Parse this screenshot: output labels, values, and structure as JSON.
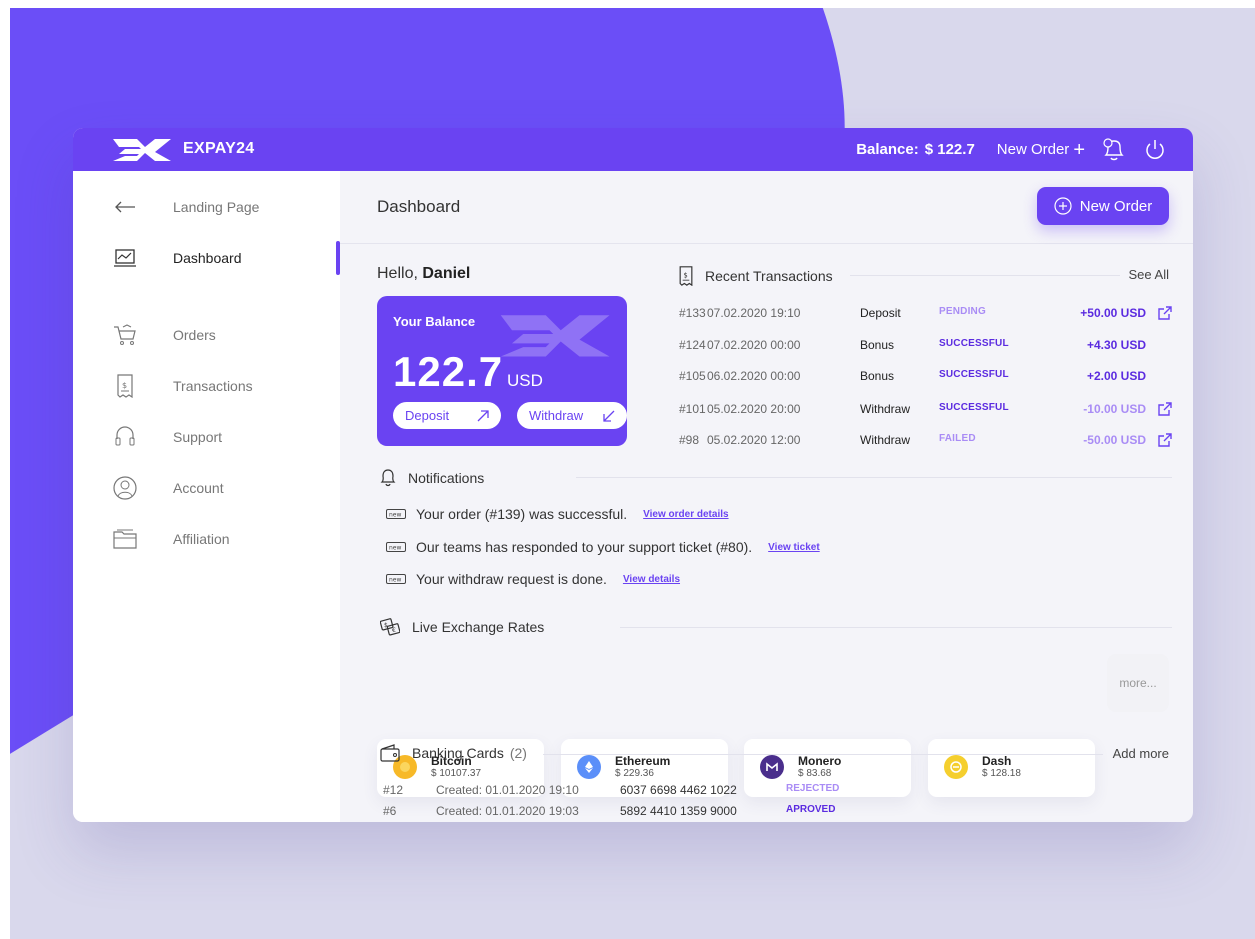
{
  "topbar": {
    "brand": "EXPAY24",
    "balance_label": "Balance:",
    "balance_value": "$ 122.7",
    "new_order_label": "New Order",
    "icons": [
      "logo-icon",
      "plus-icon",
      "notification-bell-icon",
      "power-icon"
    ]
  },
  "sidebar": {
    "items": [
      {
        "label": "Landing Page",
        "icon": "arrow-left-icon"
      },
      {
        "label": "Dashboard",
        "icon": "monitor-chart-icon",
        "active": true
      },
      {
        "label": "Orders",
        "icon": "cart-icon"
      },
      {
        "label": "Transactions",
        "icon": "receipt-icon"
      },
      {
        "label": "Support",
        "icon": "headset-icon"
      },
      {
        "label": "Account",
        "icon": "user-circle-icon"
      },
      {
        "label": "Affiliation",
        "icon": "folder-icon"
      }
    ]
  },
  "header": {
    "title": "Dashboard",
    "new_order_button": "New Order"
  },
  "greeting": {
    "prefix": "Hello,",
    "name": "Daniel"
  },
  "balance_card": {
    "label": "Your Balance",
    "amount": "122.7",
    "currency": "USD",
    "deposit_label": "Deposit",
    "withdraw_label": "Withdraw"
  },
  "transactions": {
    "title": "Recent Transactions",
    "see_all": "See All",
    "rows": [
      {
        "id": "#133",
        "date": "07.02.2020 19:10",
        "type": "Deposit",
        "status": "PENDING",
        "amount": "+50.00 USD",
        "link": true
      },
      {
        "id": "#124",
        "date": "07.02.2020 00:00",
        "type": "Bonus",
        "status": "SUCCESSFUL",
        "amount": "+4.30 USD",
        "link": false
      },
      {
        "id": "#105",
        "date": "06.02.2020 00:00",
        "type": "Bonus",
        "status": "SUCCESSFUL",
        "amount": "+2.00 USD",
        "link": false
      },
      {
        "id": "#101",
        "date": "05.02.2020 20:00",
        "type": "Withdraw",
        "status": "SUCCESSFUL",
        "amount": "-10.00 USD",
        "link": true
      },
      {
        "id": "#98",
        "date": "05.02.2020 12:00",
        "type": "Withdraw",
        "status": "FAILED",
        "amount": "-50.00 USD",
        "link": true
      }
    ]
  },
  "notifications": {
    "title": "Notifications",
    "items": [
      {
        "text": "Your order (#139) was successful.",
        "link": "View order details"
      },
      {
        "text": "Our teams has responded to your support ticket (#80).",
        "link": "View ticket"
      },
      {
        "text": "Your withdraw request is done.",
        "link": "View details"
      }
    ]
  },
  "exchange": {
    "title": "Live Exchange Rates",
    "rates": [
      {
        "name": "Bitcoin",
        "price": "$ 10107.37",
        "color": "#f7b928"
      },
      {
        "name": "Ethereum",
        "price": "$ 229.36",
        "color": "#5b8ff9"
      },
      {
        "name": "Monero",
        "price": "$ 83.68",
        "color": "#4a2e8c"
      },
      {
        "name": "Dash",
        "price": "$ 128.18",
        "color": "#f5cf2e"
      }
    ],
    "more": "more..."
  },
  "banking": {
    "title": "Banking Cards",
    "count": "(2)",
    "add_more": "Add more",
    "rows": [
      {
        "id": "#12",
        "created": "Created: 01.01.2020 19:10",
        "number": "6037 6698 4462 1022",
        "status": "REJECTED"
      },
      {
        "id": "#6",
        "created": "Created: 01.01.2020 19:03",
        "number": "5892 4410 1359 9000",
        "status": "APROVED"
      }
    ]
  },
  "colors": {
    "accent": "#6a43f2",
    "pending": "#a98cf5",
    "success": "#5b2be0",
    "failed": "#a98cf5",
    "positive": "#5b2be0",
    "negative": "#a98cf5"
  }
}
